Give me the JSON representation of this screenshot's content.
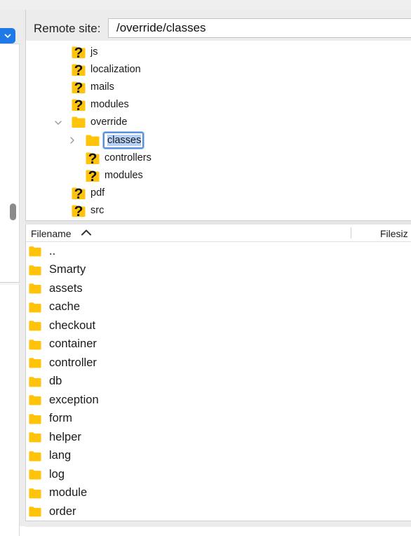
{
  "remote_site": {
    "label": "Remote site:",
    "path": "/override/classes"
  },
  "tree": {
    "nodes": [
      {
        "name": "js",
        "icon": "unknown-folder-icon"
      },
      {
        "name": "localization",
        "icon": "unknown-folder-icon"
      },
      {
        "name": "mails",
        "icon": "unknown-folder-icon"
      },
      {
        "name": "modules",
        "icon": "unknown-folder-icon"
      },
      {
        "name": "override",
        "icon": "folder-icon",
        "expanded": true
      },
      {
        "name": "classes",
        "icon": "folder-icon",
        "selected": true,
        "editing_text": "classes"
      },
      {
        "name": "controllers",
        "icon": "unknown-folder-icon"
      },
      {
        "name": "modules",
        "icon": "unknown-folder-icon"
      },
      {
        "name": "pdf",
        "icon": "unknown-folder-icon"
      },
      {
        "name": "src",
        "icon": "unknown-folder-icon"
      }
    ]
  },
  "file_list": {
    "columns": [
      "Filename",
      "Filesiz"
    ],
    "sort_column": "Filename",
    "sort_direction": "ascending",
    "rows": [
      "..",
      "Smarty",
      "assets",
      "cache",
      "checkout",
      "container",
      "controller",
      "db",
      "exception",
      "form",
      "helper",
      "lang",
      "log",
      "module",
      "order"
    ]
  },
  "colors": {
    "folder": "#FFC30A",
    "accent": "#1F7AE8",
    "selection": "#B5D1F7"
  }
}
